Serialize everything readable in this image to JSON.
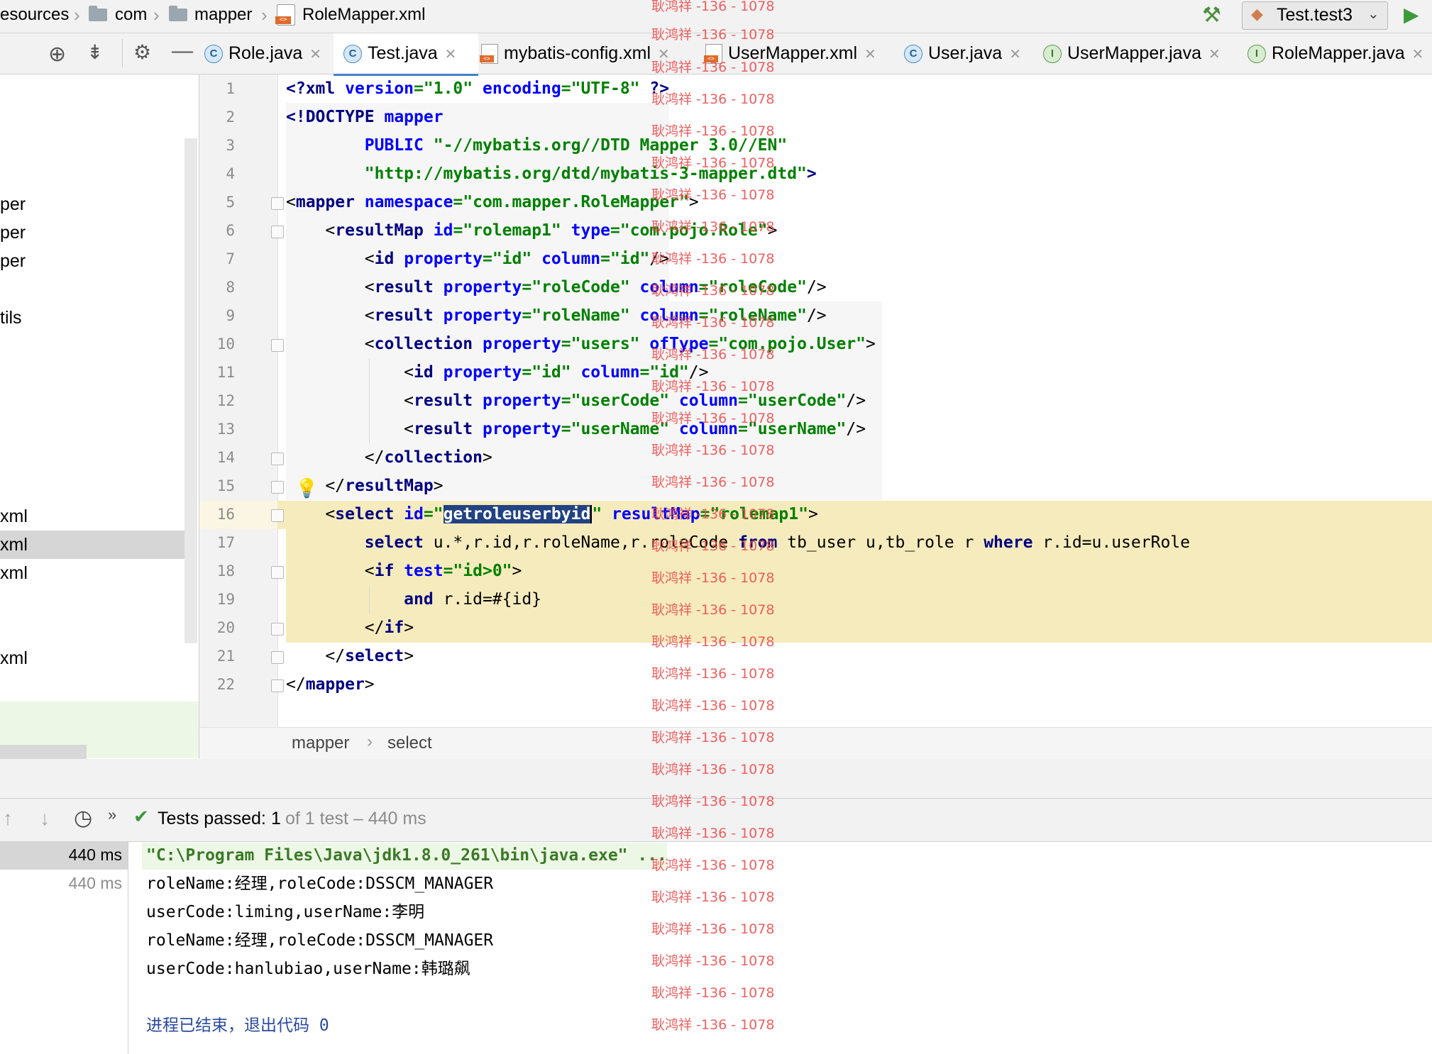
{
  "breadcrumb": {
    "items": [
      "esources",
      "com",
      "mapper",
      "RoleMapper.xml"
    ]
  },
  "run_config": {
    "label": "Test.test3"
  },
  "tabs": [
    {
      "label": "Role.java",
      "icon": "class-icon"
    },
    {
      "label": "Test.java",
      "icon": "class-icon",
      "active": true
    },
    {
      "label": "mybatis-config.xml",
      "icon": "xml-icon"
    },
    {
      "label": "UserMapper.xml",
      "icon": "xml-icon"
    },
    {
      "label": "User.java",
      "icon": "class-icon"
    },
    {
      "label": "UserMapper.java",
      "icon": "interface-icon"
    },
    {
      "label": "RoleMapper.java",
      "icon": "interface-icon"
    }
  ],
  "project_tree": {
    "items": [
      "per",
      "per",
      "per",
      "tils",
      "xml",
      "xml",
      "xml",
      "xml"
    ]
  },
  "editor": {
    "line_numbers": [
      "1",
      "2",
      "3",
      "4",
      "5",
      "6",
      "7",
      "8",
      "9",
      "10",
      "11",
      "12",
      "13",
      "14",
      "15",
      "16",
      "17",
      "18",
      "19",
      "20",
      "21",
      "22"
    ],
    "selected_id": "getroleuserbyid",
    "breadcrumb": [
      "mapper",
      "select"
    ]
  },
  "watermark": "耿鸿祥 -136 - 1078",
  "tests": {
    "status_prefix": "Tests passed:",
    "passed_count": "1",
    "status_suffix": "of 1 test – 440 ms",
    "time_selected": "440 ms",
    "time_child": "440 ms"
  },
  "console": {
    "lines": [
      "\"C:\\Program Files\\Java\\jdk1.8.0_261\\bin\\java.exe\" ...",
      "roleName:经理,roleCode:DSSCM_MANAGER",
      "userCode:liming,userName:李明",
      "roleName:经理,roleCode:DSSCM_MANAGER",
      "userCode:hanlubiao,userName:韩璐飙",
      "",
      "进程已结束，退出代码 0"
    ]
  },
  "colors": {
    "tag": "#000080",
    "attr": "#0000ff",
    "string": "#008000",
    "highlight": "#f6ebbc",
    "selection": "#214283",
    "watermark": "#ee4f4f",
    "active_tab": "#4083c9"
  }
}
